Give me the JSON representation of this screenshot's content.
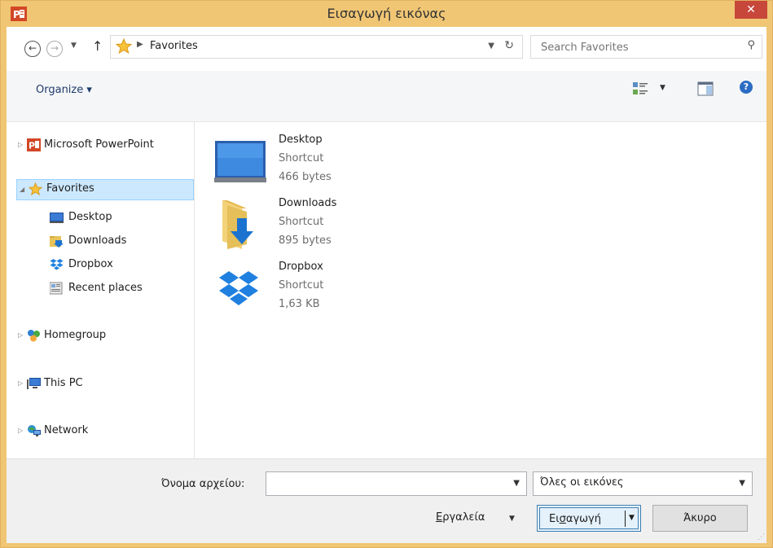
{
  "window": {
    "title": "Εισαγωγή εικόνας",
    "close_glyph": "✕"
  },
  "address": {
    "path": "Favorites",
    "search_placeholder": "Search Favorites"
  },
  "toolbar": {
    "organize_label": "Organize ▾"
  },
  "nav": {
    "items": [
      {
        "label": "Microsoft PowerPoint",
        "icon": "powerpoint-icon"
      },
      {
        "label": "Favorites",
        "icon": "star-icon",
        "selected": true
      },
      {
        "label": "Desktop",
        "icon": "desktop-icon"
      },
      {
        "label": "Downloads",
        "icon": "downloads-icon"
      },
      {
        "label": "Dropbox",
        "icon": "dropbox-icon"
      },
      {
        "label": "Recent places",
        "icon": "recent-places-icon"
      },
      {
        "label": "Homegroup",
        "icon": "homegroup-icon"
      },
      {
        "label": "This PC",
        "icon": "computer-icon"
      },
      {
        "label": "Network",
        "icon": "network-icon"
      }
    ]
  },
  "files": [
    {
      "name": "Desktop",
      "type": "Shortcut",
      "size": "466 bytes",
      "icon": "desktop-icon"
    },
    {
      "name": "Downloads",
      "type": "Shortcut",
      "size": "895 bytes",
      "icon": "downloads-folder-icon"
    },
    {
      "name": "Dropbox",
      "type": "Shortcut",
      "size": "1,63 KB",
      "icon": "dropbox-icon"
    }
  ],
  "footer": {
    "filename_label": "Όνομα αρχείου:",
    "filename_value": "",
    "filter_value": "Όλες οι εικόνες",
    "tools_label_u": "Ε",
    "tools_label_rest": "ργαλεία",
    "insert_label_pre": "Ει",
    "insert_label_u": "σ",
    "insert_label_post": "αγωγή",
    "cancel_label": "Άκυρο"
  },
  "colors": {
    "titlebar": "#f0c674",
    "close": "#c7473a",
    "selection": "#cce8ff",
    "accent_blue": "#3c7fb1"
  }
}
